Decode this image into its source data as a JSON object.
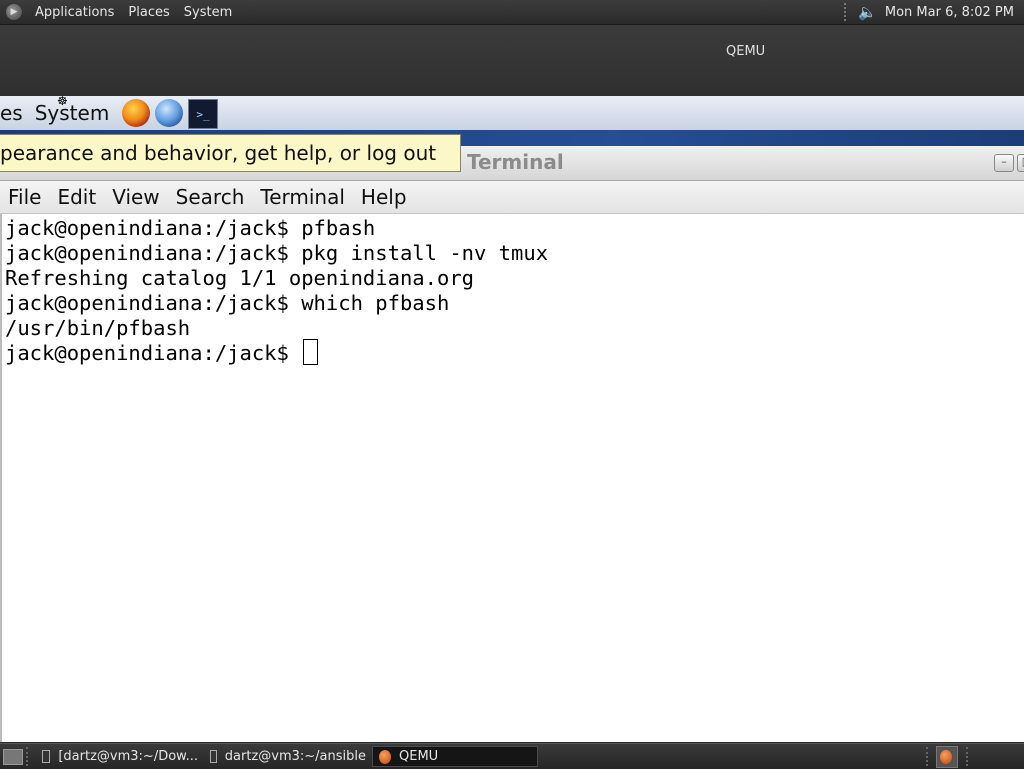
{
  "host_top_panel": {
    "menus": [
      "Applications",
      "Places",
      "System"
    ],
    "clock": "Mon Mar  6,  8:02 PM"
  },
  "qemu_window": {
    "title": "QEMU"
  },
  "guest_panel": {
    "menus_partial": [
      "es",
      "System"
    ],
    "launchers": [
      "firefox-icon",
      "thunderbird-icon",
      "terminal-icon"
    ]
  },
  "tooltip": {
    "text": "pearance and behavior, get help, or log out"
  },
  "terminal": {
    "title": "Terminal",
    "window_buttons": [
      "minimize",
      "maximize"
    ],
    "menubar": [
      "File",
      "Edit",
      "View",
      "Search",
      "Terminal",
      "Help"
    ],
    "lines": [
      "jack@openindiana:/jack$ pfbash",
      "jack@openindiana:/jack$ pkg install -nv tmux",
      "Refreshing catalog 1/1 openindiana.org",
      "jack@openindiana:/jack$ which pfbash",
      "/usr/bin/pfbash",
      "jack@openindiana:/jack$ "
    ]
  },
  "host_taskbar": {
    "tasks": [
      {
        "label": "[dartz@vm3:~/Dow...",
        "active": false
      },
      {
        "label": "dartz@vm3:~/ansible",
        "active": false
      },
      {
        "label": "QEMU",
        "active": true
      }
    ]
  }
}
